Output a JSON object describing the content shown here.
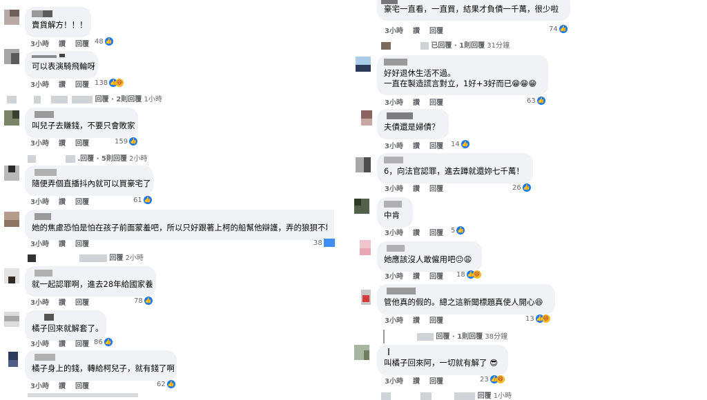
{
  "actions": {
    "like": "讚",
    "reply": "回覆"
  },
  "left": {
    "comments": [
      {
        "text": "賣貨解方！！！",
        "time": "3小時",
        "count": "48"
      },
      {
        "text": "可以表演騎飛輪呀",
        "time": "3小時",
        "count": "138"
      },
      {
        "text": "叫兒子去賺錢，不要只會敗家",
        "time": "3小時",
        "count": "159"
      },
      {
        "text": "隨便弄個直播抖內就可以買豪宅了",
        "time": "3小時",
        "count": "61"
      },
      {
        "text": "她的焦慮恐怕是怕在孩子前面蒙羞吧，所以只好跟著上柯的船幫他辯護，弄的狼狽不堪",
        "time": "3小時",
        "count": "38"
      },
      {
        "text": "就一起認罪啊，進去28年給國家養",
        "time": "3小時",
        "count": "78"
      },
      {
        "text": "橘子回來就解套了。",
        "time": "3小時",
        "count": "86"
      },
      {
        "text": "橘子身上的錢，轉給柯兒子，就有錢了啊",
        "time": "3小時",
        "count": "62"
      }
    ],
    "reply_lines": [
      {
        "text": "回覆 · 2則回覆",
        "time": "1小時"
      },
      {
        "text": ".回覆 · 5則回覆",
        "time": "2小時"
      },
      {
        "text": "回覆",
        "time": "2小時"
      }
    ]
  },
  "right": {
    "comments": [
      {
        "text": "豪宅一直看，一直買，結果才負債一千萬，很少啦",
        "time": "3小時",
        "count": "74"
      },
      {
        "text": "好好退休生活不過。",
        "text2": "一直在製造謊言對立，1好+3好而已😁😁😁",
        "time": "3小時",
        "count": "63"
      },
      {
        "text": "夫債還是婦債？",
        "time": "3小時",
        "count": "14"
      },
      {
        "text": "6，向法官認罪，進去蹲就還妳七千萬！",
        "time": "3小時",
        "count": "26"
      },
      {
        "text": "中肯",
        "time": "3小時",
        "count": "5"
      },
      {
        "text": "她應該沒人敢僱用吧😐😩",
        "time": "3小時",
        "count": "18"
      },
      {
        "text": "管他真的假的。總之這新聞標題真使人開心😆",
        "time": "3小時",
        "count": "13"
      },
      {
        "text": "叫橘子回來阿，一切就有解了 😎",
        "time": "3小時",
        "count": "23"
      }
    ],
    "reply_lines": [
      {
        "text": "已回覆 · 1則回覆",
        "time": "31分鐘"
      },
      {
        "text": "回覆 · 1則回覆",
        "time": "38分鐘"
      },
      {
        "text": "回覆",
        "time": "1小時"
      }
    ]
  }
}
